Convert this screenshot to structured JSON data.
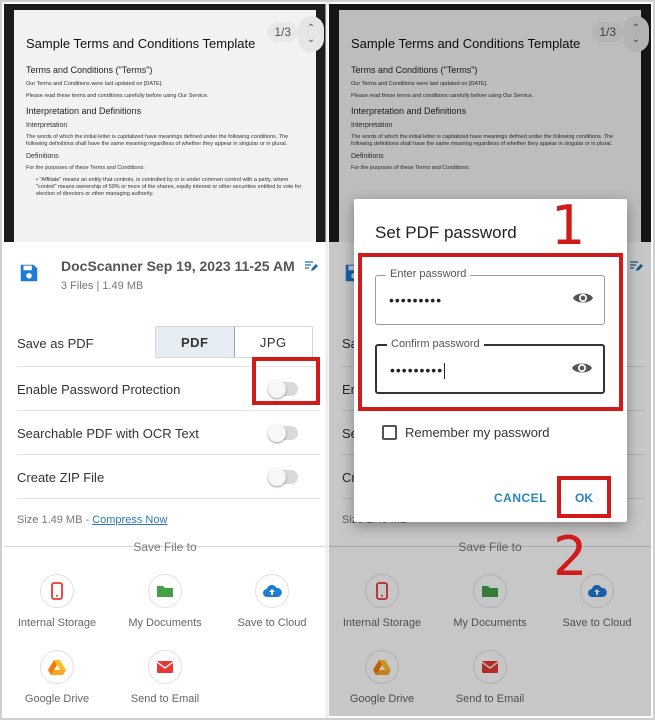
{
  "document": {
    "page_indicator": "1/3",
    "title": "Sample Terms and Conditions Template",
    "heading": "Terms and Conditions (\"Terms\")",
    "updated": "Our Terms and Conditions were last updated on [DATE].",
    "read": "Please read these terms and conditions carefully before using Our Service.",
    "section1": "Interpretation and Definitions",
    "sub1": "Interpretation",
    "interp_text": "The words of which the initial letter is capitalized have meanings defined under the following conditions. The following definitions shall have the same meaning regardless of whether they appear in singular or in plural.",
    "sub2": "Definitions",
    "def_intro": "For the purposes of these Terms and Conditions:",
    "def_item": "• \"Affiliate\" means an entity that controls, is controlled by or is under common control with a party, where \"control\" means ownership of 50% or more of the shares, equity interest or other securities entitled to vote for election of directors or other managing authority."
  },
  "sheet": {
    "file_name": "DocScanner Sep 19, 2023 11-25 AM",
    "file_meta": "3 Files  |  1.49 MB",
    "save_as_label": "Save as PDF",
    "format_pdf": "PDF",
    "format_jpg": "JPG",
    "password_label": "Enable Password Protection",
    "ocr_label": "Searchable PDF with OCR Text",
    "zip_label": "Create ZIP File",
    "size_text": "Size 1.49 MB - ",
    "compress_link": "Compress Now",
    "save_file_to": "Save File to",
    "destinations": [
      {
        "label": "Internal Storage",
        "icon": "phone-icon"
      },
      {
        "label": "My Documents",
        "icon": "folder-icon"
      },
      {
        "label": "Save to Cloud",
        "icon": "cloud-upload-icon"
      },
      {
        "label": "Google Drive",
        "icon": "google-drive-icon"
      },
      {
        "label": "Send to Email",
        "icon": "email-icon"
      }
    ]
  },
  "dialog": {
    "title": "Set PDF password",
    "enter_label": "Enter password",
    "enter_value": "•••••••••",
    "confirm_label": "Confirm password",
    "confirm_value": "•••••••••",
    "remember_label": "Remember my password",
    "cancel": "CANCEL",
    "ok": "OK"
  },
  "annotations": {
    "step1": "1",
    "step2": "2"
  },
  "colors": {
    "accent": "#2a86b8",
    "highlight": "#d11a1a",
    "save_icon": "#1e7bd6"
  }
}
